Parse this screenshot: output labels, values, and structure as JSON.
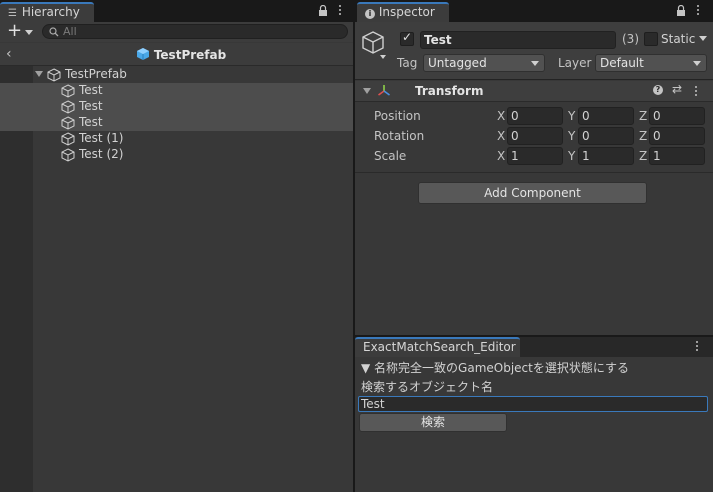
{
  "hierarchy": {
    "tab_label": "Hierarchy",
    "search_placeholder": "All",
    "breadcrumb_title": "TestPrefab",
    "root_name": "TestPrefab",
    "items": [
      {
        "label": "Test",
        "selected": true
      },
      {
        "label": "Test",
        "selected": true
      },
      {
        "label": "Test",
        "selected": true
      },
      {
        "label": "Test (1)",
        "selected": false
      },
      {
        "label": "Test (2)",
        "selected": false
      }
    ]
  },
  "inspector": {
    "tab_label": "Inspector",
    "object_name": "Test",
    "selection_count": "(3)",
    "static_label": "Static",
    "tag_label": "Tag",
    "tag_value": "Untagged",
    "layer_label": "Layer",
    "layer_value": "Default",
    "transform": {
      "title": "Transform",
      "rows": [
        {
          "label": "Position",
          "x": "0",
          "y": "0",
          "z": "0"
        },
        {
          "label": "Rotation",
          "x": "0",
          "y": "0",
          "z": "0"
        },
        {
          "label": "Scale",
          "x": "1",
          "y": "1",
          "z": "1"
        }
      ],
      "axis_x": "X",
      "axis_y": "Y",
      "axis_z": "Z"
    },
    "add_component_label": "Add Component"
  },
  "editor_window": {
    "tab_label": "ExactMatchSearch_Editor",
    "foldout_label": "▼ 名称完全一致のGameObjectを選択状態にする",
    "field_label": "検索するオブジェクト名",
    "field_value": "Test",
    "search_button_label": "検索"
  },
  "colors": {
    "accent": "#3a79bb",
    "prefab_blue": "#4aa8e8",
    "panel_bg": "#383838"
  }
}
